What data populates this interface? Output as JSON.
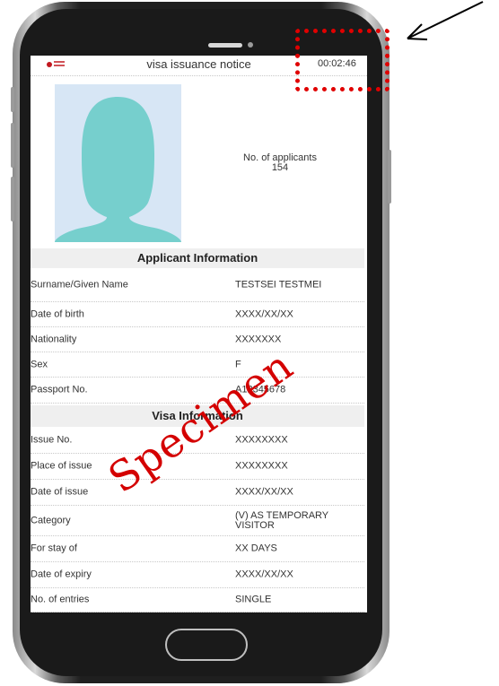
{
  "screen": {
    "title": "visa issuance notice",
    "timer": "00:02:46"
  },
  "applicants": {
    "label": "No. of applicants",
    "count": "154"
  },
  "applicant_section": {
    "heading": "Applicant Information",
    "rows": [
      {
        "label": "Surname/Given Name",
        "value": "TESTSEI TESTMEI"
      },
      {
        "label": "Date of birth",
        "value": "XXXX/XX/XX"
      },
      {
        "label": "Nationality",
        "value": "XXXXXXX"
      },
      {
        "label": "Sex",
        "value": "F"
      },
      {
        "label": "Passport No.",
        "value": "A12345678"
      }
    ]
  },
  "visa_section": {
    "heading": "Visa Information",
    "rows": [
      {
        "label": "Issue No.",
        "value": "XXXXXXXX"
      },
      {
        "label": "Place of issue",
        "value": "XXXXXXXX"
      },
      {
        "label": "Date of issue",
        "value": "XXXX/XX/XX"
      },
      {
        "label": "Category",
        "value": "(V) AS TEMPORARY VISITOR"
      },
      {
        "label": "For stay of",
        "value": "XX DAYS"
      },
      {
        "label": "Date of expiry",
        "value": "XXXX/XX/XX"
      },
      {
        "label": "No. of entries",
        "value": "SINGLE"
      }
    ]
  },
  "watermark": "Specimen",
  "colors": {
    "watermark": "#d40000",
    "highlight": "#e00000",
    "logo": "#c2181f",
    "photo_bg": "#d7e6f5",
    "silhouette": "#76cfcd"
  }
}
